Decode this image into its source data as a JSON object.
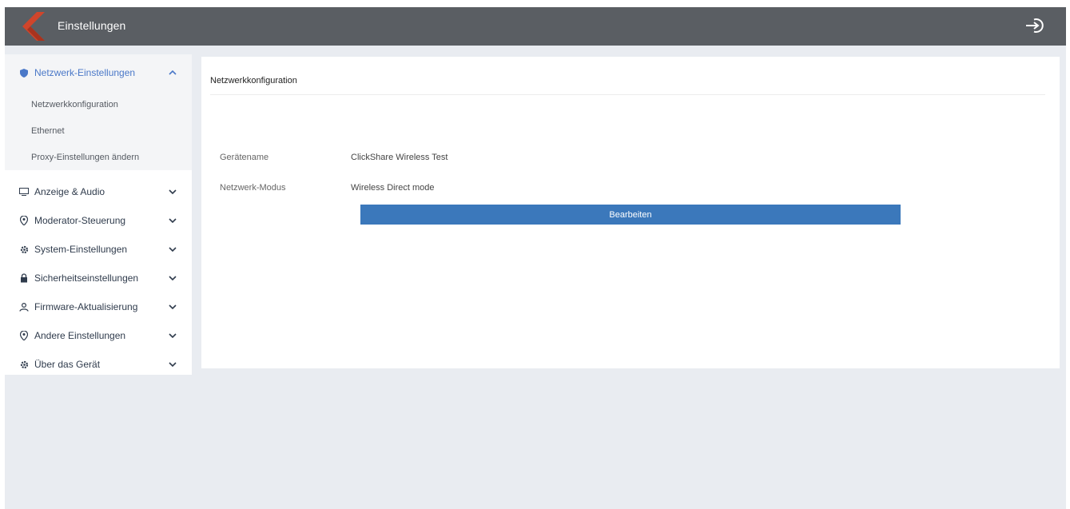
{
  "colors": {
    "topbar": "#5a5e63",
    "accent": "#4a78c8",
    "button": "#3b78bb",
    "background": "#e9ecf1",
    "logo": "#d0452b"
  },
  "header": {
    "title": "Einstellungen",
    "logo_icon": "chevron-left-logo",
    "exit_icon": "logout-icon"
  },
  "sidebar": {
    "active_group": {
      "label": "Netzwerk-Einstellungen",
      "icon": "shield-icon",
      "sub_items": [
        "Netzwerkkonfiguration",
        "Ethernet",
        "Proxy-Einstellungen ändern"
      ]
    },
    "items": [
      {
        "label": "Anzeige & Audio",
        "icon": "monitor-icon"
      },
      {
        "label": "Moderator-Steuerung",
        "icon": "location-icon"
      },
      {
        "label": "System-Einstellungen",
        "icon": "gear-icon"
      },
      {
        "label": "Sicherheitseinstellungen",
        "icon": "lock-icon"
      },
      {
        "label": "Firmware-Aktualisierung",
        "icon": "person-icon"
      },
      {
        "label": "Andere Einstellungen",
        "icon": "location-icon"
      },
      {
        "label": "Über das Gerät",
        "icon": "gear-icon"
      }
    ]
  },
  "panel": {
    "title": "Netzwerkkonfiguration",
    "fields": [
      {
        "label": "Gerätename",
        "value": "ClickShare Wireless Test"
      },
      {
        "label": "Netzwerk-Modus",
        "value": "Wireless Direct mode"
      }
    ],
    "edit_button": "Bearbeiten"
  }
}
